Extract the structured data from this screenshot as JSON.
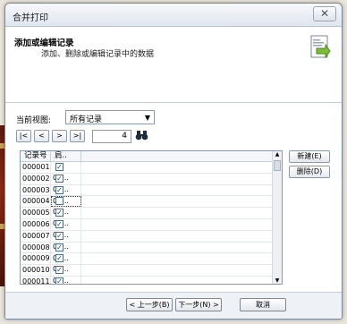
{
  "window": {
    "title": "合并打印",
    "close_glyph": "✕"
  },
  "header": {
    "title": "添加或编辑记录",
    "subtitle": "添加、删除或编辑记录中的数据"
  },
  "view": {
    "label": "当前视图:",
    "selected": "所有记录"
  },
  "nav": {
    "first": "|<",
    "prev": "<",
    "next": ">",
    "last": ">|",
    "record_number": "4",
    "find_icon": "binoculars-icon"
  },
  "grid": {
    "col1": "记录号",
    "col2": "肩..",
    "rows": [
      {
        "id": "000001",
        "checked": true,
        "value": "00..."
      },
      {
        "id": "000002",
        "checked": true,
        "value": "00..."
      },
      {
        "id": "000003",
        "checked": true,
        "value": "00..."
      },
      {
        "id": "000004",
        "checked": false,
        "value": "00..."
      },
      {
        "id": "000005",
        "checked": true,
        "value": "00..."
      },
      {
        "id": "000006",
        "checked": true,
        "value": "00..."
      },
      {
        "id": "000007",
        "checked": true,
        "value": "00..."
      },
      {
        "id": "000008",
        "checked": true,
        "value": "00..."
      },
      {
        "id": "000009",
        "checked": true,
        "value": "00..."
      },
      {
        "id": "000010",
        "checked": true,
        "value": "00..."
      },
      {
        "id": "000011",
        "checked": true,
        "value": "00..."
      }
    ]
  },
  "side": {
    "new": "新建(E)",
    "delete": "删除(D)"
  },
  "footer": {
    "back": "< 上一步(B)",
    "next": "下一步(N) >",
    "cancel": "取消"
  }
}
